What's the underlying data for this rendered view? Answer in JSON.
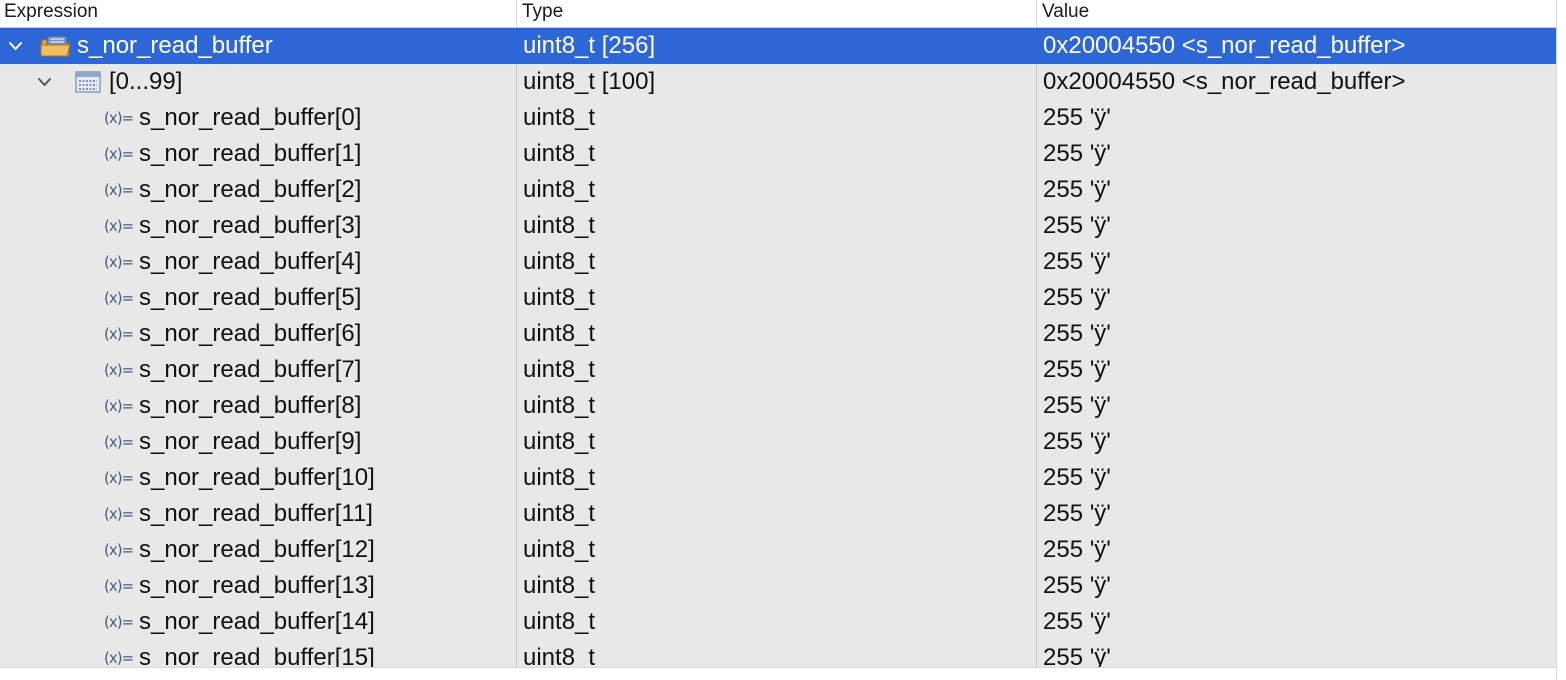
{
  "columns": {
    "expression": "Expression",
    "type": "Type",
    "value": "Value"
  },
  "colors": {
    "selection": "#2d66d6",
    "background": "#e8e8e8"
  },
  "rows": [
    {
      "expr": "s_nor_read_buffer",
      "type": "uint8_t [256]",
      "value": "0x20004550 <s_nor_read_buffer>",
      "icon": "array-folder-icon",
      "expanded": true,
      "selected": true
    },
    {
      "expr": "[0...99]",
      "type": "uint8_t [100]",
      "value": "0x20004550 <s_nor_read_buffer>",
      "icon": "array-range-icon",
      "expanded": true
    },
    {
      "expr": "s_nor_read_buffer[0]",
      "type": "uint8_t",
      "value": "255 'ÿ'",
      "icon": "variable-icon"
    },
    {
      "expr": "s_nor_read_buffer[1]",
      "type": "uint8_t",
      "value": "255 'ÿ'",
      "icon": "variable-icon"
    },
    {
      "expr": "s_nor_read_buffer[2]",
      "type": "uint8_t",
      "value": "255 'ÿ'",
      "icon": "variable-icon"
    },
    {
      "expr": "s_nor_read_buffer[3]",
      "type": "uint8_t",
      "value": "255 'ÿ'",
      "icon": "variable-icon"
    },
    {
      "expr": "s_nor_read_buffer[4]",
      "type": "uint8_t",
      "value": "255 'ÿ'",
      "icon": "variable-icon"
    },
    {
      "expr": "s_nor_read_buffer[5]",
      "type": "uint8_t",
      "value": "255 'ÿ'",
      "icon": "variable-icon"
    },
    {
      "expr": "s_nor_read_buffer[6]",
      "type": "uint8_t",
      "value": "255 'ÿ'",
      "icon": "variable-icon"
    },
    {
      "expr": "s_nor_read_buffer[7]",
      "type": "uint8_t",
      "value": "255 'ÿ'",
      "icon": "variable-icon"
    },
    {
      "expr": "s_nor_read_buffer[8]",
      "type": "uint8_t",
      "value": "255 'ÿ'",
      "icon": "variable-icon"
    },
    {
      "expr": "s_nor_read_buffer[9]",
      "type": "uint8_t",
      "value": "255 'ÿ'",
      "icon": "variable-icon"
    },
    {
      "expr": "s_nor_read_buffer[10]",
      "type": "uint8_t",
      "value": "255 'ÿ'",
      "icon": "variable-icon"
    },
    {
      "expr": "s_nor_read_buffer[11]",
      "type": "uint8_t",
      "value": "255 'ÿ'",
      "icon": "variable-icon"
    },
    {
      "expr": "s_nor_read_buffer[12]",
      "type": "uint8_t",
      "value": "255 'ÿ'",
      "icon": "variable-icon"
    },
    {
      "expr": "s_nor_read_buffer[13]",
      "type": "uint8_t",
      "value": "255 'ÿ'",
      "icon": "variable-icon"
    },
    {
      "expr": "s_nor_read_buffer[14]",
      "type": "uint8_t",
      "value": "255 'ÿ'",
      "icon": "variable-icon"
    },
    {
      "expr": "s_nor_read_buffer[15]",
      "type": "uint8_t",
      "value": "255 'ÿ'",
      "icon": "variable-icon"
    }
  ]
}
